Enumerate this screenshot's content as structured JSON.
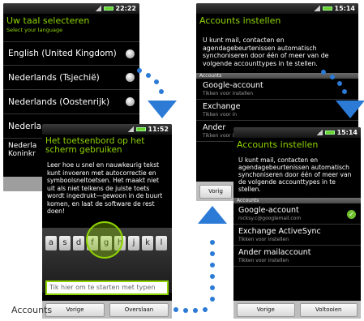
{
  "caption": "Accounts",
  "phone1": {
    "time": "22:22",
    "title": "Uw taal selecteren",
    "subtitle": "Select your language",
    "items": [
      {
        "label": "English (United Kingdom)"
      },
      {
        "label": "Nederlands (Tsjechië)"
      },
      {
        "label": "Nederlands (Oostenrijk)"
      },
      {
        "label": "Nederla"
      },
      {
        "label": "Nederla"
      },
      {
        "label": "Koninkr"
      }
    ]
  },
  "phone2": {
    "time": "11:52",
    "title": "Het toetsenbord op het scherm gebruiken",
    "description": "Leer hoe u snel en nauwkeurig tekst kunt invoeren met autocorrectie en symboolsneltoetsen. Het maakt niet uit als niet telkens de juiste toets wordt ingedrukt—gewoon in de buurt komen, en laat de software de rest doen!",
    "keys": [
      "a",
      "s",
      "d",
      "f",
      "g",
      "h",
      "j",
      "k",
      "l"
    ],
    "input_placeholder": "Tik hier om te starten met typen",
    "back": "Vorige",
    "skip": "Overslaan"
  },
  "phone3": {
    "time": "15:14",
    "title": "Accounts instellen",
    "description": "U kunt mail, contacten en agendagebeurtenissen automatisch synchoniseren door één of meer van de volgende accounttypes in te stellen.",
    "section": "Accounts",
    "items": [
      {
        "name": "Google-account",
        "sub": "Tikken voor instellen"
      },
      {
        "name": "Exchange",
        "sub": "Tikken voor in"
      },
      {
        "name": "Ander ",
        "sub": "Tikken voor in"
      }
    ],
    "back": "Vorig"
  },
  "phone4": {
    "time": "15:14",
    "title": "Accounts instellen",
    "description": "U kunt mail, contacten en agendagebeurtenissen automatisch synchoniseren door één of meer van de volgende accounttypes in te stellen.",
    "section": "Accounts",
    "items": [
      {
        "name": "Google-account",
        "sub": "nicksy.c@googlemail.com"
      },
      {
        "name": "Exchange ActiveSync",
        "sub": "Tikken voor instellen"
      },
      {
        "name": "Ander mailaccount",
        "sub": "Tikken voor instellen"
      }
    ],
    "back": "Vorige",
    "done": "Voltooien"
  },
  "colors": {
    "accent": "#8fd400",
    "arrow": "#2b7bd6"
  }
}
